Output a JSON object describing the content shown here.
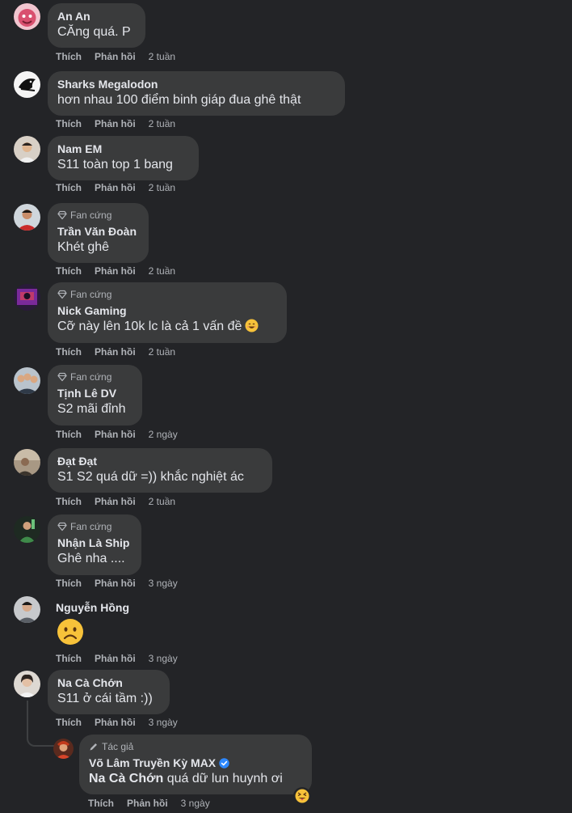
{
  "labels": {
    "like": "Thích",
    "reply": "Phản hồi",
    "fan_badge": "Fan cứng",
    "author_badge": "Tác giả"
  },
  "comments": [
    {
      "name": "An An",
      "text": "CĂng quá. P",
      "time": "2 tuần"
    },
    {
      "name": "Sharks Megalodon",
      "text": "hơn nhau 100 điểm binh giáp đua ghê thật",
      "time": "2 tuần"
    },
    {
      "name": "Nam EM",
      "text": "S11 toàn top 1 bang",
      "time": "2 tuần"
    },
    {
      "name": "Trần Văn Đoàn",
      "text": "Khét ghê",
      "time": "2 tuần",
      "badge": "Fan cứng"
    },
    {
      "name": "Nick Gaming",
      "text": "Cỡ này lên 10k lc là cả 1 vấn đề",
      "time": "2 tuần",
      "badge": "Fan cứng",
      "emoji": "grinning-emoji"
    },
    {
      "name": "Tịnh Lê DV",
      "text": "S2 mãi đỉnh",
      "time": "2 ngày",
      "badge": "Fan cứng"
    },
    {
      "name": "Đạt Đạt",
      "text": "S1 S2 quá dữ =)) khắc nghiệt ác",
      "time": "2 tuần"
    },
    {
      "name": "Nhận Là Ship",
      "text": "Ghê nha ....",
      "time": "3 ngày",
      "badge": "Fan cứng"
    },
    {
      "name": "Nguyễn Hồng",
      "emoji": "frowning-emoji",
      "time": "3 ngày"
    },
    {
      "name": "Na Cà Chớn",
      "text": "S11 ở cái tầm :))",
      "time": "3 ngày"
    }
  ],
  "reply": {
    "badge": "Tác giả",
    "name": "Võ Lâm Truyền Kỳ MAX",
    "verified": true,
    "mention": "Na Cà Chớn",
    "text": " quá dữ lun huynh ơi",
    "time": "3 ngày",
    "reaction": "squinting-tongue-emoji"
  },
  "colors": {
    "background": "#232427",
    "bubble": "#3a3b3c",
    "text": "#e4e6eb",
    "secondary": "#b0b3b8",
    "verified": "#2d88ff"
  }
}
